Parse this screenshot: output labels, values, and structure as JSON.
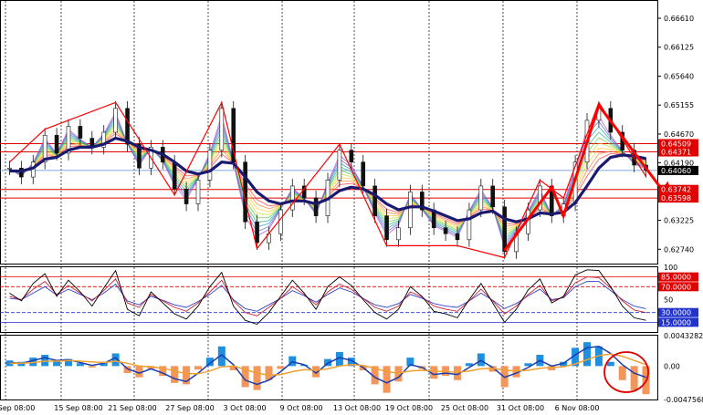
{
  "colors": {
    "background": "#ffffff",
    "grid": "#000000",
    "price_line": "#5b8dd9",
    "ema_main": "#1a1a6e",
    "resistance": "#e00000",
    "candles": "#111111",
    "zigzag": "#ff0000",
    "rsi_fast": "#000000",
    "rsi_mid": "#cc2233",
    "rsi_slow": "#3344cc",
    "macd_pos": "#1f8fe0",
    "macd_neg": "#f4955a",
    "macd_line": "#1a3cb0",
    "signal_line": "#f0a030"
  },
  "chart_data": [
    {
      "type": "line",
      "panel": "price",
      "x_tick_labels": [
        "Sep 08:00",
        "15 Sep 08:00",
        "21 Sep 08:00",
        "27 Sep 08:00",
        "3 Oct 08:00",
        "9 Oct 08:00",
        "13 Oct 08:00",
        "19 Oct 08:00",
        "25 Oct 08:00",
        "31 Oct 08:00",
        "6 Nov 08:00"
      ],
      "y_tick_labels": [
        "0.66610",
        "0.66125",
        "0.65640",
        "0.65155",
        "0.64670",
        "0.64190",
        "0.63705",
        "0.63225",
        "0.62740"
      ],
      "ylim": [
        0.625,
        0.669
      ],
      "current_price_label": "0.64060",
      "horizontal_levels": [
        {
          "label": "0.64509",
          "value": 0.64509
        },
        {
          "label": "0.64371",
          "value": 0.64371
        },
        {
          "label": "0.63742",
          "value": 0.63742
        },
        {
          "label": "0.63598",
          "value": 0.63598
        }
      ],
      "close": [
        0.641,
        0.6395,
        0.642,
        0.6465,
        0.6435,
        0.648,
        0.646,
        0.6445,
        0.647,
        0.651,
        0.645,
        0.641,
        0.6445,
        0.642,
        0.6375,
        0.635,
        0.639,
        0.644,
        0.651,
        0.642,
        0.632,
        0.6285,
        0.63,
        0.634,
        0.638,
        0.636,
        0.633,
        0.639,
        0.644,
        0.642,
        0.638,
        0.633,
        0.629,
        0.631,
        0.637,
        0.634,
        0.631,
        0.63,
        0.629,
        0.634,
        0.638,
        0.6345,
        0.627,
        0.63,
        0.634,
        0.638,
        0.633,
        0.635,
        0.642,
        0.649,
        0.651,
        0.647,
        0.644,
        0.6415,
        0.6406
      ],
      "ema": [
        0.6405,
        0.6405,
        0.641,
        0.6425,
        0.6428,
        0.644,
        0.6445,
        0.6445,
        0.645,
        0.646,
        0.6455,
        0.6445,
        0.644,
        0.6433,
        0.642,
        0.6405,
        0.64,
        0.6405,
        0.642,
        0.6418,
        0.6395,
        0.637,
        0.6355,
        0.635,
        0.6355,
        0.6355,
        0.635,
        0.6358,
        0.6372,
        0.6378,
        0.6375,
        0.6365,
        0.635,
        0.634,
        0.6345,
        0.6345,
        0.6338,
        0.633,
        0.6322,
        0.6325,
        0.6335,
        0.6338,
        0.6325,
        0.632,
        0.6325,
        0.6335,
        0.6333,
        0.6336,
        0.6352,
        0.638,
        0.641,
        0.6428,
        0.6432,
        0.643,
        0.6426
      ]
    },
    {
      "type": "line",
      "panel": "rsi",
      "y_tick_labels": [
        "100",
        "50"
      ],
      "levels": [
        {
          "label": "85.0000",
          "value": 85
        },
        {
          "label": "70.0000",
          "value": 70
        },
        {
          "label": "30.0000",
          "value": 30
        },
        {
          "label": "15.0000",
          "value": 15
        }
      ],
      "ylim": [
        0,
        100
      ],
      "fast": [
        60,
        48,
        75,
        90,
        55,
        80,
        62,
        40,
        68,
        95,
        35,
        25,
        62,
        45,
        28,
        20,
        40,
        70,
        92,
        40,
        18,
        12,
        30,
        55,
        80,
        60,
        35,
        70,
        85,
        72,
        50,
        30,
        20,
        35,
        70,
        55,
        32,
        28,
        22,
        50,
        75,
        45,
        15,
        35,
        65,
        82,
        45,
        55,
        88,
        96,
        95,
        70,
        40,
        22,
        18
      ],
      "mid": [
        55,
        50,
        66,
        78,
        58,
        72,
        60,
        48,
        64,
        82,
        45,
        38,
        58,
        48,
        38,
        32,
        45,
        62,
        80,
        48,
        30,
        25,
        38,
        52,
        70,
        58,
        42,
        62,
        74,
        66,
        52,
        38,
        32,
        40,
        62,
        54,
        40,
        35,
        32,
        48,
        66,
        48,
        28,
        40,
        58,
        72,
        48,
        54,
        76,
        85,
        84,
        68,
        48,
        34,
        30
      ],
      "slow": [
        52,
        50,
        60,
        70,
        57,
        66,
        58,
        50,
        60,
        74,
        48,
        42,
        55,
        49,
        42,
        38,
        47,
        58,
        72,
        50,
        36,
        32,
        42,
        52,
        64,
        56,
        46,
        58,
        68,
        62,
        52,
        42,
        38,
        44,
        58,
        52,
        44,
        40,
        38,
        48,
        60,
        49,
        36,
        44,
        56,
        66,
        50,
        53,
        70,
        78,
        78,
        64,
        50,
        40,
        36
      ]
    },
    {
      "type": "bar",
      "panel": "macd",
      "y_tick_labels": [
        "0.0043282",
        "0.00",
        "-0.0047568"
      ],
      "ylim": [
        -0.0047568,
        0.0043282
      ],
      "histogram": [
        0.0008,
        0.0006,
        0.0012,
        0.0016,
        0.0007,
        0.001,
        0.0004,
        -0.0002,
        0.0006,
        0.0018,
        -0.001,
        -0.0016,
        -0.0004,
        -0.0014,
        -0.0024,
        -0.0026,
        -0.0005,
        0.0012,
        0.0028,
        -0.0006,
        -0.003,
        -0.0034,
        -0.002,
        -0.0004,
        0.0014,
        0.0002,
        -0.0016,
        0.001,
        0.002,
        0.0012,
        -0.0006,
        -0.0026,
        -0.0038,
        -0.0022,
        0.0012,
        -0.0004,
        -0.0018,
        -0.0014,
        -0.002,
        0.0004,
        0.0018,
        -0.0008,
        -0.003,
        -0.0016,
        0.0004,
        0.0016,
        -0.0006,
        0.0006,
        0.0026,
        0.0034,
        0.0028,
        0.0006,
        -0.002,
        -0.0034,
        -0.004
      ],
      "macd": [
        0.0005,
        0.0004,
        0.0008,
        0.0012,
        0.0008,
        0.0009,
        0.0005,
        0.0001,
        0.0004,
        0.0012,
        -0.0004,
        -0.001,
        -0.0004,
        -0.001,
        -0.0018,
        -0.0022,
        -0.001,
        0.0004,
        0.0016,
        0.0002,
        -0.002,
        -0.0026,
        -0.002,
        -0.0008,
        0.0006,
        0.0002,
        -0.001,
        0.0004,
        0.0012,
        0.0008,
        -0.0002,
        -0.0016,
        -0.0024,
        -0.0016,
        0.0002,
        -0.0002,
        -0.0012,
        -0.001,
        -0.0012,
        -0.0002,
        0.0008,
        -0.0002,
        -0.0016,
        -0.001,
        -0.0002,
        0.0008,
        0.0,
        0.0004,
        0.0016,
        0.0026,
        0.0028,
        0.0018,
        0.0002,
        -0.001,
        -0.0016
      ],
      "signal": [
        0.0004,
        0.0004,
        0.0005,
        0.0007,
        0.0007,
        0.0008,
        0.0007,
        0.0006,
        0.0005,
        0.0007,
        0.0004,
        0.0,
        -0.0001,
        -0.0003,
        -0.0007,
        -0.0011,
        -0.0011,
        -0.0007,
        -0.0001,
        0.0,
        -0.0005,
        -0.001,
        -0.0013,
        -0.0012,
        -0.0008,
        -0.0005,
        -0.0006,
        -0.0004,
        0.0,
        0.0002,
        0.0001,
        -0.0003,
        -0.0008,
        -0.001,
        -0.0007,
        -0.0006,
        -0.0007,
        -0.0008,
        -0.0009,
        -0.0007,
        -0.0004,
        -0.0003,
        -0.0006,
        -0.0007,
        -0.0006,
        -0.0003,
        -0.0002,
        -0.0001,
        0.0003,
        0.0009,
        0.0015,
        0.0017,
        0.0014,
        0.0008,
        0.0002
      ]
    }
  ]
}
